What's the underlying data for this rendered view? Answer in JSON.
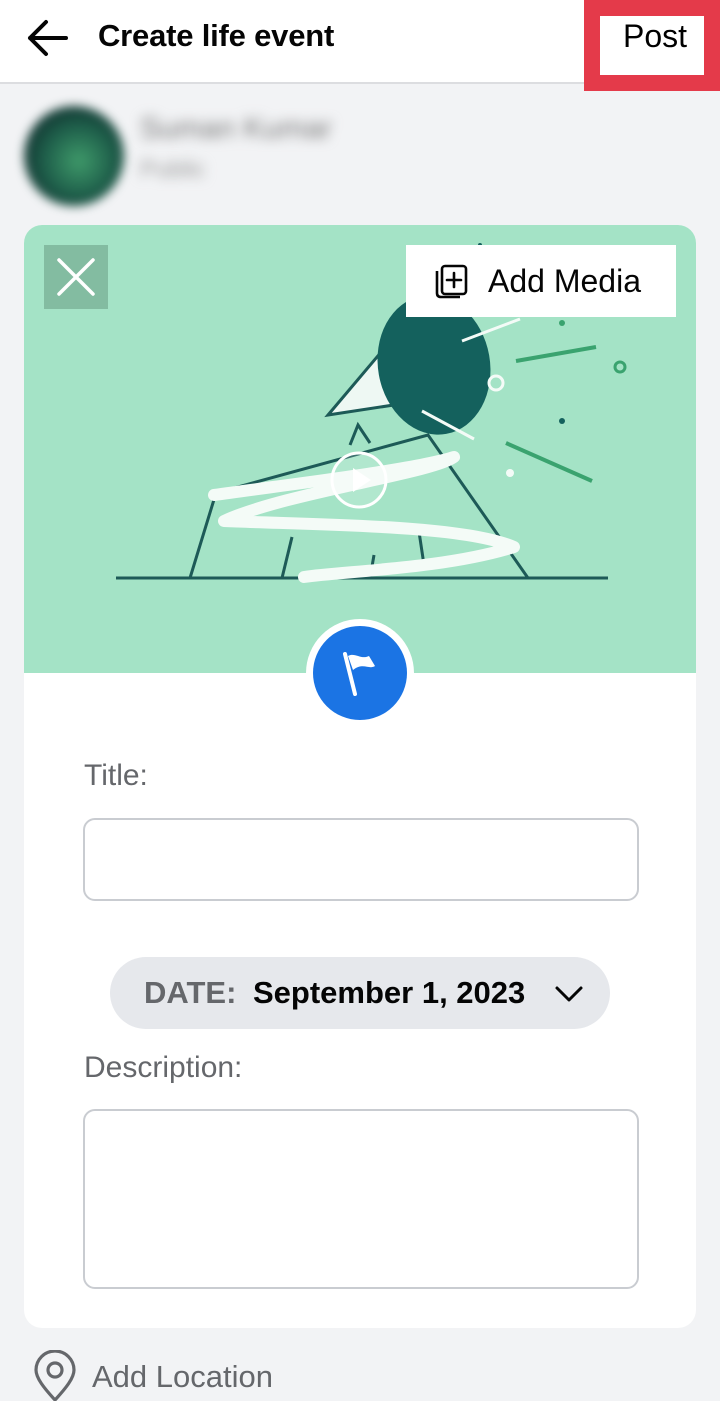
{
  "header": {
    "title": "Create life event",
    "post_label": "Post",
    "back_icon": "arrow-left-icon"
  },
  "profile": {
    "name": "Suman Kumar",
    "audience": "Public"
  },
  "banner": {
    "add_media_label": "Add Media",
    "add_media_icon": "add-media-icon",
    "close_icon": "close-icon",
    "play_icon": "play-icon",
    "background_color": "#a4e3c6"
  },
  "event_icon": "flag-icon",
  "form": {
    "title_label": "Title:",
    "title_value": "",
    "date_prefix": "DATE:",
    "date_value": "September 1, 2023",
    "description_label": "Description:",
    "description_value": ""
  },
  "location": {
    "label": "Add Location",
    "icon": "location-pin-icon"
  },
  "colors": {
    "accent": "#1b74e4",
    "highlight_border": "#e43a4a"
  }
}
